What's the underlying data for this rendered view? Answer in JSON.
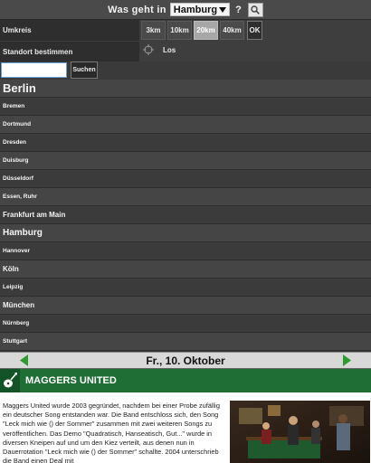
{
  "header": {
    "question": "Was geht in",
    "selected_city": "Hamburg",
    "question_mark": "?"
  },
  "umkreis": {
    "label": "Umkreis",
    "locate_label": "Standort bestimmen",
    "radius_options": [
      "3km",
      "10km",
      "20km",
      "40km"
    ],
    "selected_radius": "20km",
    "ok_label": "OK",
    "go_label": "Los"
  },
  "search": {
    "value": "",
    "placeholder": "",
    "button_label": "Suchen"
  },
  "cities": [
    {
      "name": "Berlin",
      "size": "s1"
    },
    {
      "name": "Bremen",
      "size": "s4"
    },
    {
      "name": "Dortmund",
      "size": "s4"
    },
    {
      "name": "Dresden",
      "size": "s4"
    },
    {
      "name": "Duisburg",
      "size": "s4"
    },
    {
      "name": "Düsseldorf",
      "size": "s4"
    },
    {
      "name": "Essen, Ruhr",
      "size": "s4"
    },
    {
      "name": "Frankfurt am Main",
      "size": "s3"
    },
    {
      "name": "Hamburg",
      "size": "s2"
    },
    {
      "name": "Hannover",
      "size": "s4"
    },
    {
      "name": "Köln",
      "size": "s3"
    },
    {
      "name": "Leipzig",
      "size": "s4"
    },
    {
      "name": "München",
      "size": "s3"
    },
    {
      "name": "Nürnberg",
      "size": "s4"
    },
    {
      "name": "Stuttgart",
      "size": "s4"
    }
  ],
  "datebar": {
    "date": "Fr., 10. Oktober",
    "prev_icon": "arrow-left-icon",
    "next_icon": "arrow-right-icon",
    "arrow_color": "#2e9b2e"
  },
  "event": {
    "title": "MAGGERS UNITED",
    "icon": "guitar-icon",
    "header_color": "#1f6e35",
    "description": "Maggers United wurde 2003 gegründet, nachdem bei einer Probe zufällig ein deutscher Song entstanden war. Die Band entschloss sich, den Song \"Leck mich wie () der Sommer\" zusammen mit zwei weiteren Songs zu veröffentlichen. Das Demo \"Quadratisch, Hanseatisch, Gut...\" wurde in diversen Kneipen auf und um den Kiez verteilt, aus denen nun in Dauerrotation \"Leck mich wie () der Sommer\" schallte. 2004 unterschrieb die Band einen Deal mit"
  }
}
